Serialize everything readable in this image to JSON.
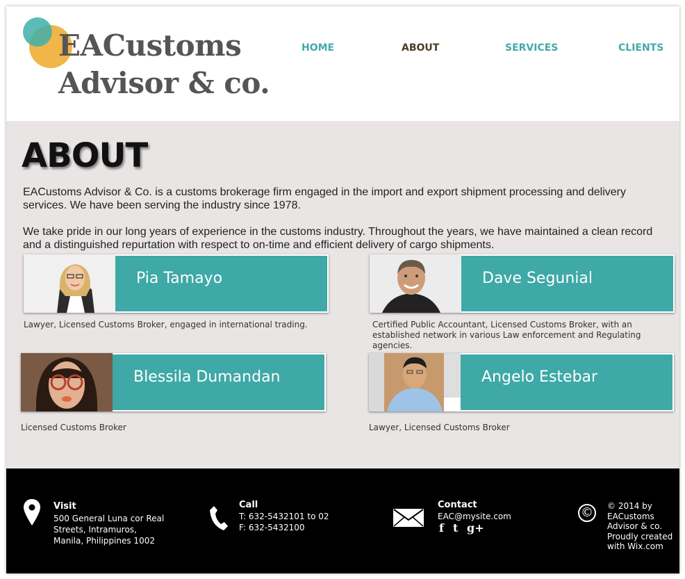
{
  "header": {
    "logo_line1": "EACustoms",
    "logo_line2": "Advisor & co.",
    "nav": [
      {
        "label": "HOME"
      },
      {
        "label": "ABOUT"
      },
      {
        "label": "SERVICES"
      },
      {
        "label": "CLIENTS"
      }
    ],
    "active_nav": "ABOUT"
  },
  "main": {
    "title": "ABOUT",
    "paragraph1": "EACustoms Advisor & Co. is a customs brokerage firm engaged in the import and export shipment processing and delivery services. We have been serving the industry since 1978.",
    "paragraph2": "We take pride in our long years of experience in the customs industry. Throughout the years, we have maintained a clean record and a distinguished repurtation with respect to on-time and efficient delivery of cargo shipments.",
    "team": [
      {
        "name": "Pia Tamayo",
        "description": "Lawyer, Licensed Customs Broker, engaged in international trading."
      },
      {
        "name": "Dave Segunial",
        "description": "Certified Public Accountant, Licensed Customs Broker, with an established network in various Law enforcement and Regulating agencies."
      },
      {
        "name": "Blessila Dumandan",
        "description": "Licensed Customs Broker"
      },
      {
        "name": "Angelo Estebar",
        "description": "Lawyer, Licensed Customs Broker"
      }
    ]
  },
  "footer": {
    "visit_title": "Visit",
    "visit_text_1": "500 General Luna cor Real",
    "visit_text_2": "Streets, Intramuros,",
    "visit_text_3": "Manila, Philippines 1002",
    "call_title": "Call",
    "call_phone": "T: 632-5432101 to 02",
    "call_fax": "F: 632-5432100",
    "contact_title": "Contact",
    "contact_email": "EAC@mysite.com",
    "social": [
      {
        "icon": "facebook-icon",
        "glyph": "f"
      },
      {
        "icon": "twitter-icon",
        "glyph": "t"
      },
      {
        "icon": "google-plus-icon",
        "glyph": "g+"
      }
    ],
    "copyright_symbol": "©",
    "copyright_lines": [
      "© 2014 by",
      "EACustoms",
      "Advisor & co.",
      "Proudly created",
      "with Wix.com"
    ]
  },
  "colors": {
    "accent_teal": "#3ea9a6",
    "logo_orange": "#f0b649",
    "nav_active": "#4b3b26",
    "main_bg": "#e8e5e4",
    "footer_bg": "#000000"
  }
}
